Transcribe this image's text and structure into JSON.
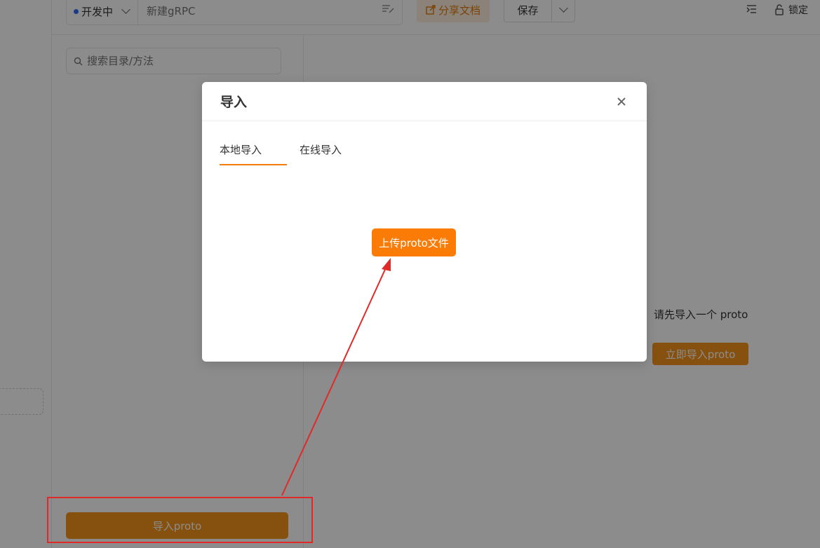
{
  "topbar": {
    "env_label": "开发中",
    "name_placeholder": "新建gRPC",
    "share_label": "分享文档",
    "save_label": "保存",
    "lock_label": "锁定"
  },
  "sidebar": {
    "search_placeholder": "搜索目录/方法",
    "import_button_label": "导入proto"
  },
  "main": {
    "empty_hint": "请先导入一个 proto",
    "import_now_label": "立即导入proto"
  },
  "modal": {
    "title": "导入",
    "tabs": [
      {
        "label": "本地导入",
        "active": true
      },
      {
        "label": "在线导入",
        "active": false
      }
    ],
    "upload_button_label": "上传proto文件"
  },
  "colors": {
    "accent": "#fb7b07",
    "annotation": "#e02a2a",
    "env_dot": "#2d6cf6"
  }
}
